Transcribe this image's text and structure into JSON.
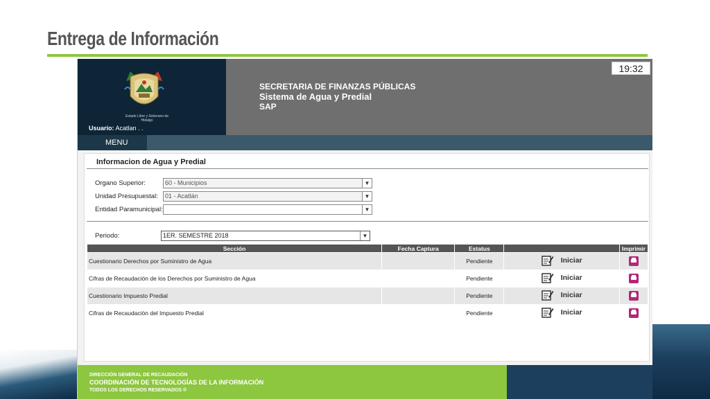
{
  "slide": {
    "title": "Entrega de Información"
  },
  "header": {
    "secretaria": "SECRETARIA DE FINANZAS PÚBLICAS",
    "sistema": "Sistema de Agua y Predial",
    "sap": "SAP",
    "clock": "19:32",
    "crest_text": "Estado Libre y Soberano de Hidalgo",
    "user_label": "Usuario:",
    "user_value": "Acatlan . ."
  },
  "menu": {
    "label": "MENU"
  },
  "panel": {
    "title": "Informacion de Agua y Predial",
    "organo_label": "Organo Superior:",
    "organo_value": "60 - Municipios",
    "unidad_label": "Unidad Presupuestal:",
    "unidad_value": "01 - Acatlán",
    "entidad_label": "Entidad Paramunicipal:",
    "entidad_value": "",
    "periodo_label": "Periodo:",
    "periodo_value": "1ER. SEMESTRE 2018"
  },
  "table": {
    "headers": {
      "seccion": "Sección",
      "fecha": "Fecha Captura",
      "estatus": "Estatus",
      "accion": "",
      "imprimir": "Imprimir"
    },
    "rows": [
      {
        "seccion": "Cuestionario Derechos por Suministro de Agua",
        "fecha": "",
        "estatus": "Pendiente",
        "accion": "Iniciar"
      },
      {
        "seccion": "Cifras de Recaudación de los Derechos por Suministro de Agua",
        "fecha": "",
        "estatus": "Pendiente",
        "accion": "Iniciar"
      },
      {
        "seccion": "Cuestionario Impuesto Predial",
        "fecha": "",
        "estatus": "Pendiente",
        "accion": "Iniciar"
      },
      {
        "seccion": "Cifras de Recaudación del Impuesto Predial",
        "fecha": "",
        "estatus": "Pendiente",
        "accion": "Iniciar"
      }
    ]
  },
  "footer": {
    "line1": "DIRECCIÓN GENERAL DE RECAUDACIÓN",
    "line2": "COORDINACIÓN DE TECNOLOGÍAS DE LA INFORMACIÓN",
    "line3": "TODOS LOS DERECHOS RESERVADOS ®"
  },
  "colors": {
    "accent_green": "#8dc63f",
    "header_dark": "#0d2536",
    "header_gray": "#6f6f6f",
    "print_magenta": "#b0287a"
  }
}
